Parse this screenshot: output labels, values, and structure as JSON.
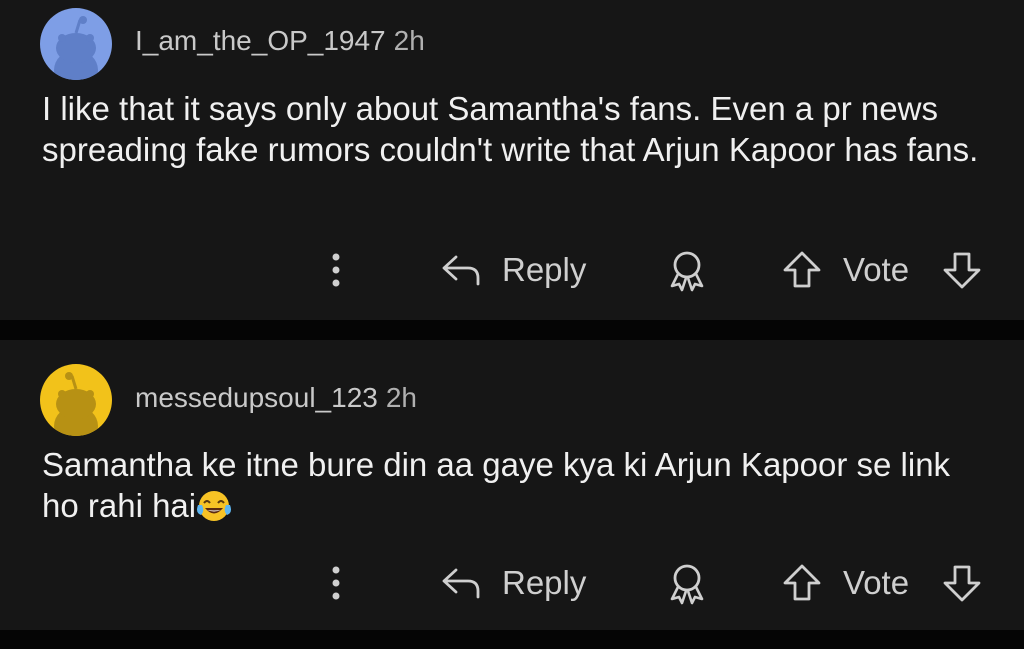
{
  "comments": [
    {
      "username": "I_am_the_OP_1947",
      "timestamp": "2h",
      "avatar_color": "#7e9ee6",
      "body": "I like that it says only about Samantha's fans. Even a pr news spreading fake rumors couldn't write that Arjun Kapoor has fans.",
      "actions": {
        "reply_label": "Reply",
        "vote_label": "Vote"
      }
    },
    {
      "username": "messedupsoul_123",
      "timestamp": "2h",
      "avatar_color": "#f2c21a",
      "body": "Samantha ke itne bure din aa gaye kya ki Arjun Kapoor se link ho rahi hai",
      "body_emoji": "face-with-tears-of-joy",
      "actions": {
        "reply_label": "Reply",
        "vote_label": "Vote"
      }
    }
  ],
  "icons": {
    "more": "more-vertical-icon",
    "reply": "reply-arrow-icon",
    "award": "award-icon",
    "upvote": "upvote-arrow-icon",
    "downvote": "downvote-arrow-icon"
  },
  "colors": {
    "background": "#0b0b0b",
    "card": "#161616",
    "text": "#f0f0f0",
    "muted": "#c9c9c9"
  }
}
